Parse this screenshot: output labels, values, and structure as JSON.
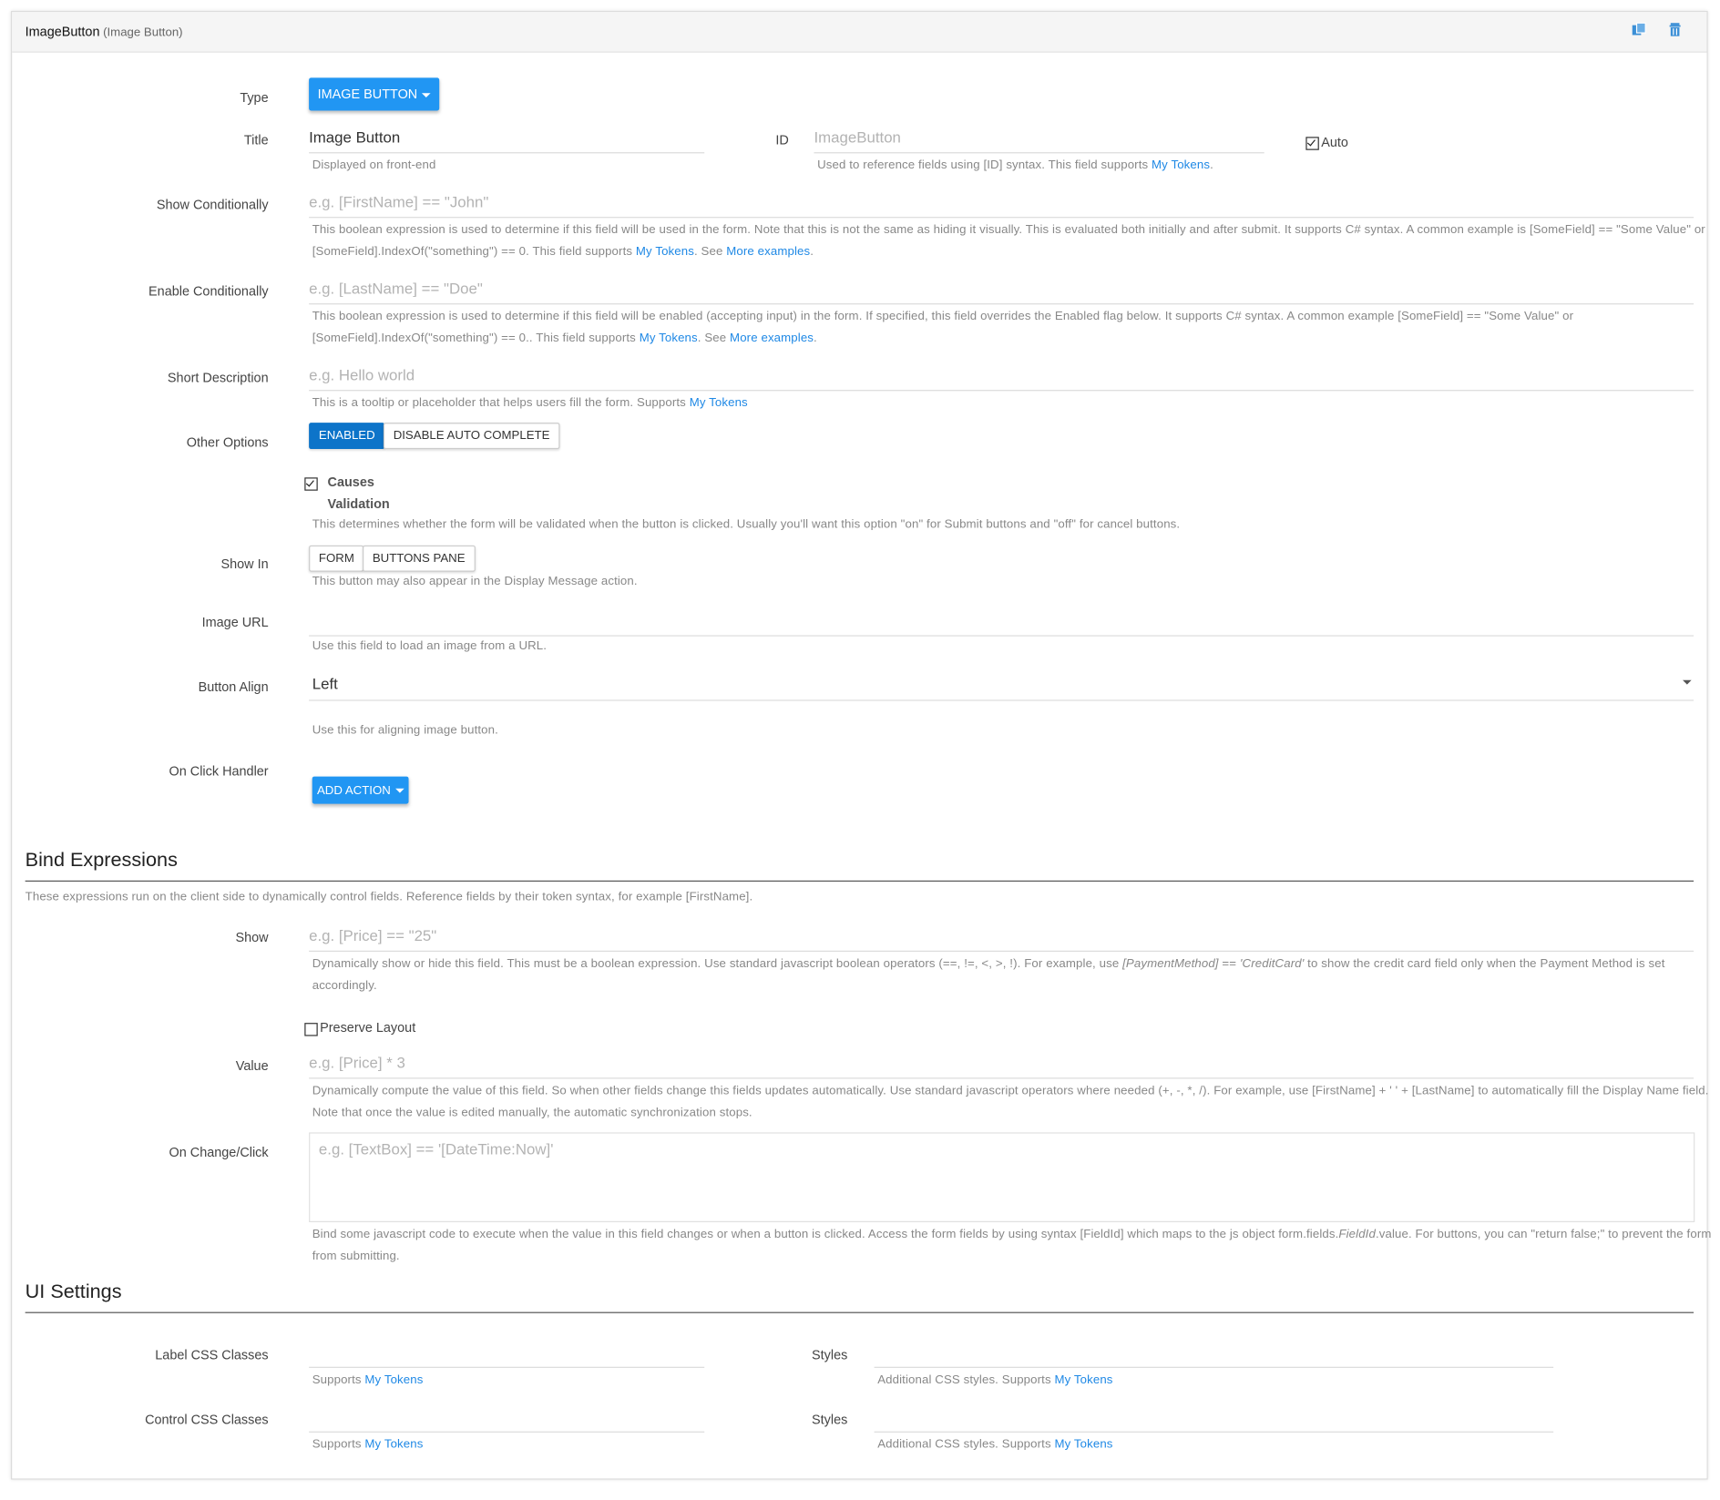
{
  "header": {
    "title": "ImageButton",
    "subtitle": "(Image Button)",
    "icons": [
      "copy-icon",
      "trash-icon"
    ]
  },
  "type": {
    "label": "Type",
    "button": "IMAGE BUTTON"
  },
  "title_field": {
    "label": "Title",
    "value": "Image Button",
    "help": "Displayed on front-end"
  },
  "id_field": {
    "label": "ID",
    "placeholder": "ImageButton",
    "help_prefix": "Used to reference fields using [ID] syntax. This field supports ",
    "help_link": "My Tokens",
    "help_suffix": ".",
    "auto_label": "Auto",
    "auto_checked": true
  },
  "show_conditionally": {
    "label": "Show Conditionally",
    "placeholder": "e.g. [FirstName] == \"John\"",
    "help_line1": "This boolean expression is used to determine if this field will be used in the form. Note that this is not the same as hiding it visually. This is evaluated both initially and after submit. It supports C# syntax. A common example is [SomeField] == \"Some Value\" or",
    "help_line2_prefix": "[SomeField].IndexOf(\"something\") == 0. This field supports ",
    "help_link1": "My Tokens",
    "help_mid": ". See ",
    "help_link2": "More examples",
    "help_suffix": "."
  },
  "enable_conditionally": {
    "label": "Enable Conditionally",
    "placeholder": "e.g. [LastName] == \"Doe\"",
    "help_line1": "This boolean expression is used to determine if this field will be enabled (accepting input) in the form. If specified, this field overrides the Enabled flag below. It supports C# syntax. A common example [SomeField] == \"Some Value\" or",
    "help_line2_prefix": "[SomeField].IndexOf(\"something\") == 0.. This field supports ",
    "help_link1": "My Tokens",
    "help_mid": ". See ",
    "help_link2": "More examples",
    "help_suffix": "."
  },
  "short_description": {
    "label": "Short Description",
    "placeholder": "e.g. Hello world",
    "help_prefix": "This is a tooltip or placeholder that helps users fill the form. Supports ",
    "help_link": "My Tokens"
  },
  "other_options": {
    "label": "Other Options",
    "enabled": "ENABLED",
    "disable_auto_complete": "DISABLE AUTO COMPLETE",
    "causes_line1": "Causes",
    "causes_line2": "Validation",
    "causes_checked": true,
    "causes_help": "This determines whether the form will be validated when the button is clicked. Usually you'll want this option \"on\" for Submit buttons and \"off\" for cancel buttons."
  },
  "show_in": {
    "label": "Show In",
    "form": "FORM",
    "buttons_pane": "BUTTONS PANE",
    "help": "This button may also appear in the Display Message action."
  },
  "image_url": {
    "label": "Image URL",
    "value": "",
    "help": "Use this field to load an image from a URL."
  },
  "button_align": {
    "label": "Button Align",
    "value": "Left",
    "help": "Use this for aligning image button."
  },
  "on_click": {
    "label": "On Click Handler",
    "button": "ADD ACTION"
  },
  "bind": {
    "title": "Bind Expressions",
    "intro": "These expressions run on the client side to dynamically control fields. Reference fields by their token syntax, for example [FirstName].",
    "show_label": "Show",
    "show_placeholder": "e.g. [Price] == \"25\"",
    "show_help_prefix": "Dynamically show or hide this field. This must be a boolean expression. Use standard javascript boolean operators (==, !=, <, >, !). For example, use ",
    "show_help_em1": "[PaymentMethod]",
    "show_help_mid": " == ",
    "show_help_em2": "'CreditCard'",
    "show_help_suffix": " to show the credit card field only when the Payment Method is set",
    "show_help_line2": "accordingly.",
    "preserve_layout": "Preserve Layout",
    "preserve_checked": false,
    "value_label": "Value",
    "value_placeholder": "e.g. [Price] * 3",
    "value_help_line1": "Dynamically compute the value of this field. So when other fields change this fields updates automatically. Use standard javascript operators where needed (+, -, *, /). For example, use [FirstName] + ' ' + [LastName] to automatically fill the Display Name field.",
    "value_help_line2": "Note that once the value is edited manually, the automatic synchronization stops.",
    "change_label": "On Change/Click",
    "change_placeholder": "e.g. [TextBox] == '[DateTime:Now]'",
    "change_help_prefix": "Bind some javascript code to execute when the value in this field changes or when a button is clicked. Access the form fields by using syntax [FieldId] which maps to the js object form.fields.",
    "change_help_em": "FieldId",
    "change_help_suffix": ".value. For buttons, you can \"return false;\" to prevent the form",
    "change_help_line2": "from submitting."
  },
  "ui": {
    "title": "UI Settings",
    "label_css": "Label CSS Classes",
    "control_css": "Control CSS Classes",
    "styles1": "Styles",
    "styles2": "Styles",
    "supports_prefix": "Supports ",
    "supports_link": "My Tokens",
    "styles_help_prefix": "Additional CSS styles. Supports ",
    "styles_help_link": "My Tokens"
  },
  "colors": {
    "primary": "#2196f3",
    "toggle_on": "#0d74c9",
    "link": "#1e88e5"
  }
}
